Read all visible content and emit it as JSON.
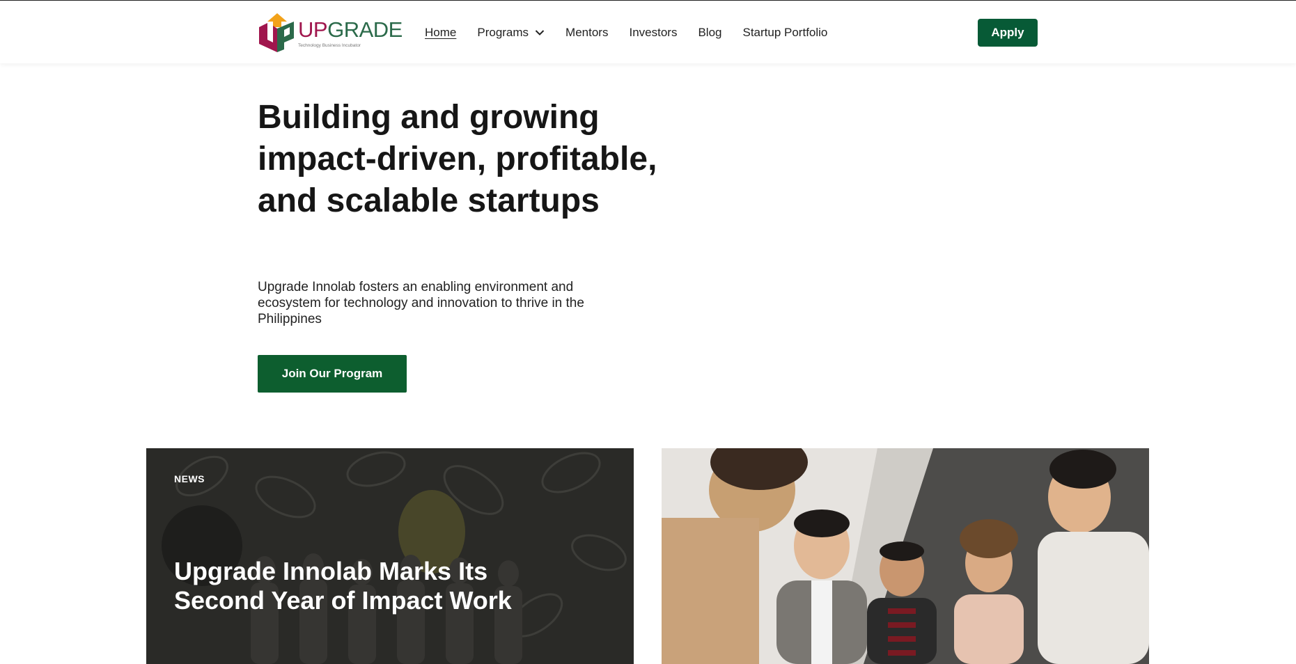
{
  "brand": {
    "logo_up": "UP",
    "logo_grade": "GRADE",
    "tagline": "Technology Business Incubator",
    "colors": {
      "primary_green": "#075a36",
      "magenta": "#a0164d",
      "orange": "#f2a21a"
    }
  },
  "nav": {
    "items": [
      {
        "label": "Home",
        "active": true
      },
      {
        "label": "Programs",
        "has_dropdown": true,
        "icon": "chevron-down-icon"
      },
      {
        "label": "Mentors"
      },
      {
        "label": "Investors"
      },
      {
        "label": "Blog"
      },
      {
        "label": "Startup Portfolio"
      }
    ],
    "apply_label": "Apply"
  },
  "hero": {
    "title": "Building and growing impact-driven, profitable, and scalable startups",
    "subtitle": "Upgrade Innolab fosters an enabling environment and ecosystem for technology and innovation to thrive in the Philippines",
    "cta_label": "Join Our Program"
  },
  "cards": [
    {
      "tag": "NEWS",
      "title": "Upgrade Innolab Marks Its Second Year of Impact Work",
      "image": "team-photo-bloom-cafe"
    },
    {
      "image": "smiling-team-photo"
    }
  ]
}
